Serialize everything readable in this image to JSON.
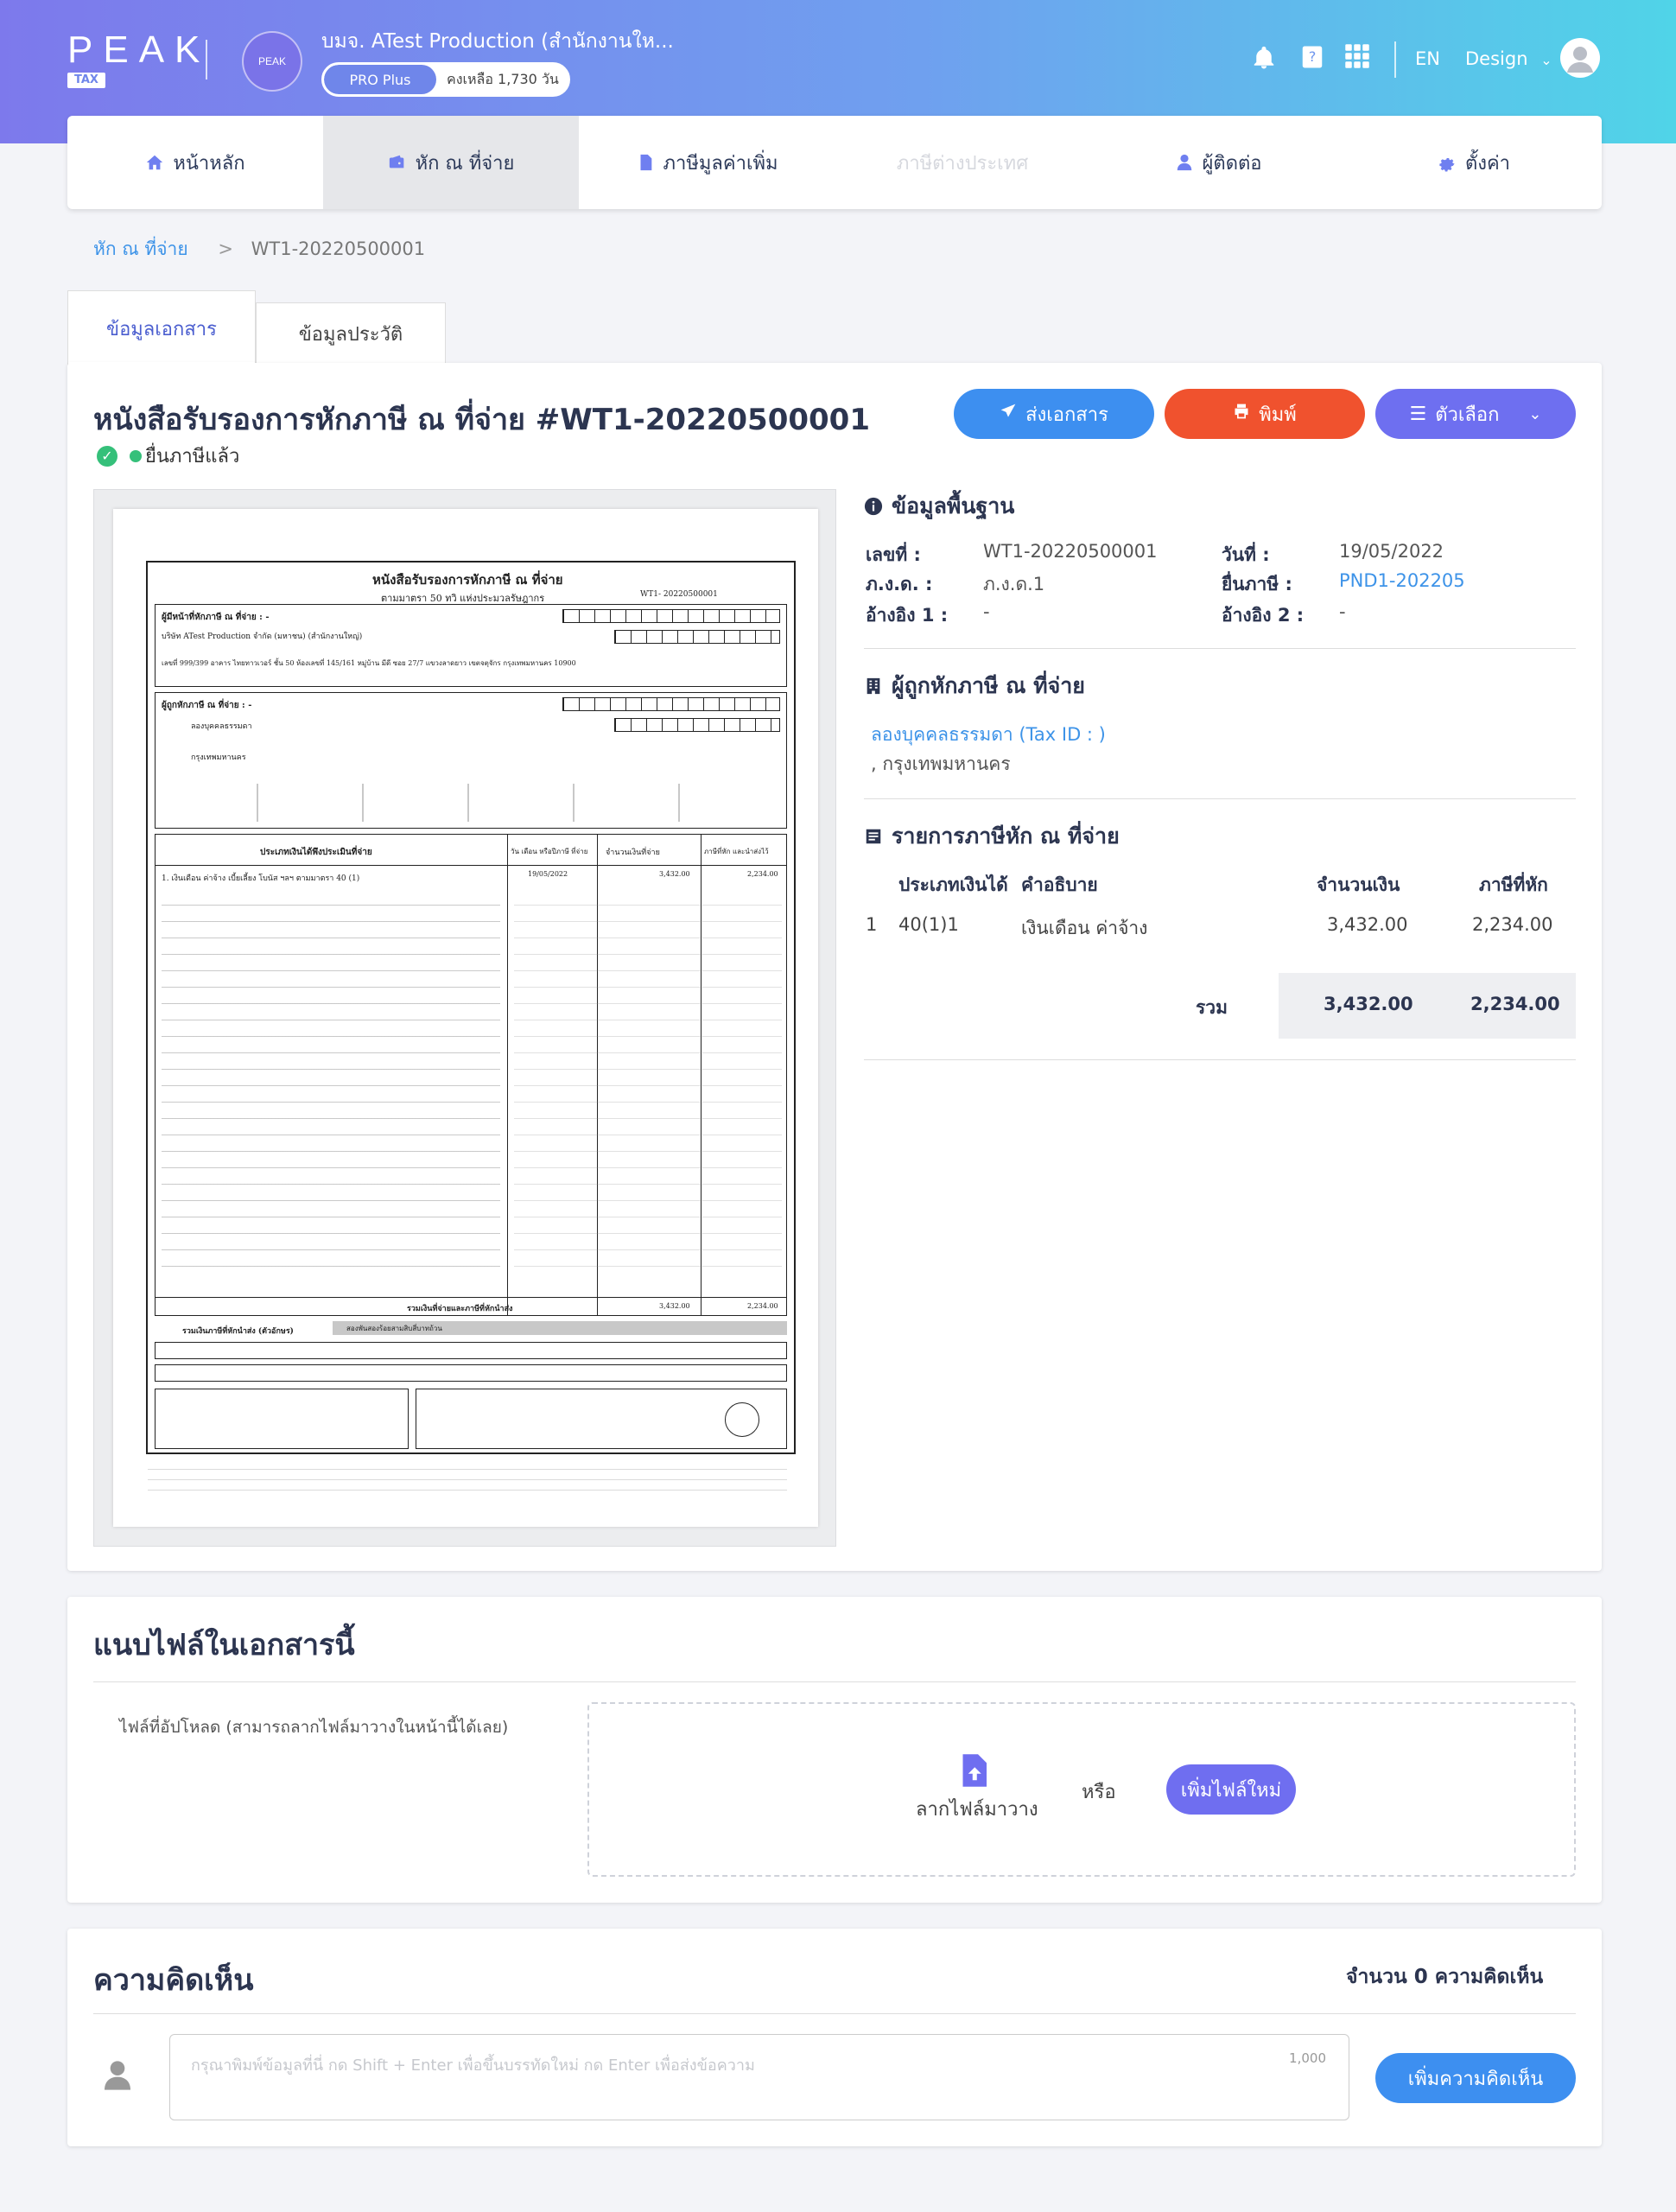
{
  "header": {
    "logo_text": "PEAK",
    "logo_sub": "TAX",
    "org_badge": "PEAK",
    "org_name": "บมจ. ATest Production (สำนักงานให...",
    "plan": "PRO Plus",
    "plan_remaining": "คงเหลือ 1,730 วัน",
    "lang": "EN",
    "user_name": "Design"
  },
  "nav": {
    "items": [
      {
        "label": "หน้าหลัก",
        "icon": "home-icon"
      },
      {
        "label": "หัก ณ ที่จ่าย",
        "icon": "wallet-icon"
      },
      {
        "label": "ภาษีมูลค่าเพิ่ม",
        "icon": "document-icon"
      },
      {
        "label": "ภาษีต่างประเทศ",
        "icon": ""
      },
      {
        "label": "ผู้ติดต่อ",
        "icon": "user-icon"
      },
      {
        "label": "ตั้งค่า",
        "icon": "gear-icon"
      }
    ]
  },
  "breadcrumb": {
    "parent": "หัก ณ ที่จ่าย",
    "current": "WT1-20220500001"
  },
  "tabs": {
    "document": "ข้อมูลเอกสาร",
    "history": "ข้อมูลประวัติ"
  },
  "document": {
    "title": "หนังสือรับรองการหักภาษี ณ ที่จ่าย #WT1-20220500001",
    "status": "ยื่นภาษีแล้ว",
    "buttons": {
      "send": "ส่งเอกสาร",
      "print": "พิมพ์",
      "options": "ตัวเลือก"
    }
  },
  "colors": {
    "send": "#3d8ff0",
    "print": "#f0522e",
    "options": "#6e6ff0",
    "accent": "#4b5ecf",
    "link": "#3d93e8"
  },
  "basic_info": {
    "heading": "ข้อมูลพื้นฐาน",
    "number_label": "เลขที่ :",
    "number_value": "WT1-20220500001",
    "date_label": "วันที่ :",
    "date_value": "19/05/2022",
    "form_label": "ภ.ง.ด. :",
    "form_value": "ภ.ง.ด.1",
    "filing_label": "ยื่นภาษี :",
    "filing_value": "PND1-202205",
    "ref1_label": "อ้างอิง 1 :",
    "ref1_value": "-",
    "ref2_label": "อ้างอิง 2 :",
    "ref2_value": "-"
  },
  "payee": {
    "heading": "ผู้ถูกหักภาษี ณ ที่จ่าย",
    "name": "ลองบุคคลธรรมดา (Tax ID : )",
    "address": ", กรุงเทพมหานคร"
  },
  "items": {
    "heading": "รายการภาษีหัก ณ ที่จ่าย",
    "columns": [
      "ประเภทเงินได้",
      "คำอธิบาย",
      "จำนวนเงิน",
      "ภาษีที่หัก"
    ],
    "rows": [
      {
        "no": "1",
        "type": "40(1)1",
        "desc": "เงินเดือน ค่าจ้าง",
        "amount": "3,432.00",
        "tax": "2,234.00"
      }
    ],
    "total_label": "รวม",
    "total_amount": "3,432.00",
    "total_tax": "2,234.00"
  },
  "attach": {
    "heading": "แนบไฟล์ในเอกสารนี้",
    "label": "ไฟล์ที่อัปโหลด (สามารถลากไฟล์มาวางในหน้านี้ได้เลย)",
    "drag": "ลากไฟล์มาวาง",
    "or": "หรือ",
    "add": "เพิ่มไฟล์ใหม่"
  },
  "comments": {
    "heading": "ความคิดเห็น",
    "count": "จำนวน 0 ความคิดเห็น",
    "placeholder": "กรุณาพิมพ์ข้อมูลที่นี่ กด Shift + Enter เพื่อขึ้นบรรทัดใหม่ กด Enter เพื่อส่งข้อความ",
    "char_limit": "1,000",
    "submit": "เพิ่มความคิดเห็น"
  },
  "form_preview": {
    "title": "หนังสือรับรองการหักภาษี ณ ที่จ่าย",
    "subtitle": "ตามมาตรา 50 ทวิ แห่งประมวลรัษฎากร",
    "doc_no": "WT1- 20220500001",
    "payer_label": "ผู้มีหน้าที่หักภาษี ณ ที่จ่าย : -",
    "payer_name": "บริษัท ATest Production จำกัด (มหาชน) (สำนักงานใหญ่)",
    "payer_address": "เลขที่ 999/399 อาคาร ไทยทาวเวอร์ ชั้น 50 ห้องเลขที่ 145/161 หมู่บ้าน มีดี ซอย 27/7 แขวงลาดยาว เขตจตุจักร กรุงเทพมหานคร 10900",
    "payee_label": "ผู้ถูกหักภาษี ณ ที่จ่าย : -",
    "payee_name": "ลองบุคคลธรรมดา",
    "payee_address": "กรุงเทพมหานคร",
    "column_headers": [
      "ประเภทเงินได้พึงประเมินที่จ่าย",
      "วัน เดือน หรือปีภาษี ที่จ่าย",
      "จำนวนเงินที่จ่าย",
      "ภาษีที่หัก และนำส่งไว้"
    ],
    "row1": "1. เงินเดือน ค่าจ้าง เบี้ยเลี้ยง โบนัส ฯลฯ ตามมาตรา 40 (1)",
    "row1_date": "19/05/2022",
    "row1_amount": "3,432.00",
    "row1_tax": "2,234.00",
    "total_label": "รวมเงินที่จ่ายและภาษีที่หักนำส่ง",
    "total_words_label": "รวมเงินภาษีที่หักนำส่ง (ตัวอักษร)",
    "total_words": "สองพันสองร้อยสามสิบสี่บาทถ้วน"
  }
}
